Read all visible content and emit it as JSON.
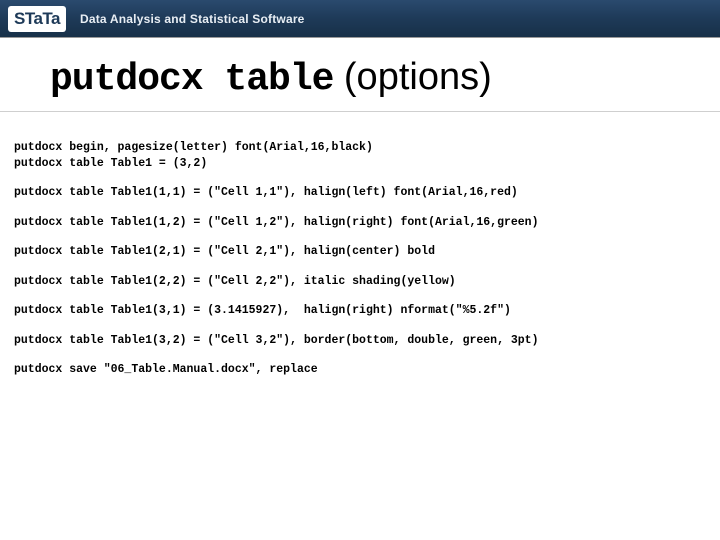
{
  "banner": {
    "logo": "STaTa",
    "tagline": "Data Analysis and Statistical Software"
  },
  "title": {
    "mono": "putdocx table",
    "sans": "(options)"
  },
  "code": {
    "l1": "putdocx begin, pagesize(letter) font(Arial,16,black)",
    "l2": "putdocx table Table1 = (3,2)",
    "l3": "putdocx table Table1(1,1) = (\"Cell 1,1\"), halign(left) font(Arial,16,red)",
    "l4": "putdocx table Table1(1,2) = (\"Cell 1,2\"), halign(right) font(Arial,16,green)",
    "l5": "putdocx table Table1(2,1) = (\"Cell 2,1\"), halign(center) bold",
    "l6": "putdocx table Table1(2,2) = (\"Cell 2,2\"), italic shading(yellow)",
    "l7": "putdocx table Table1(3,1) = (3.1415927),  halign(right) nformat(\"%5.2f\")",
    "l8": "putdocx table Table1(3,2) = (\"Cell 3,2\"), border(bottom, double, green, 3pt)",
    "l9": "putdocx save \"06_Table.Manual.docx\", replace"
  }
}
